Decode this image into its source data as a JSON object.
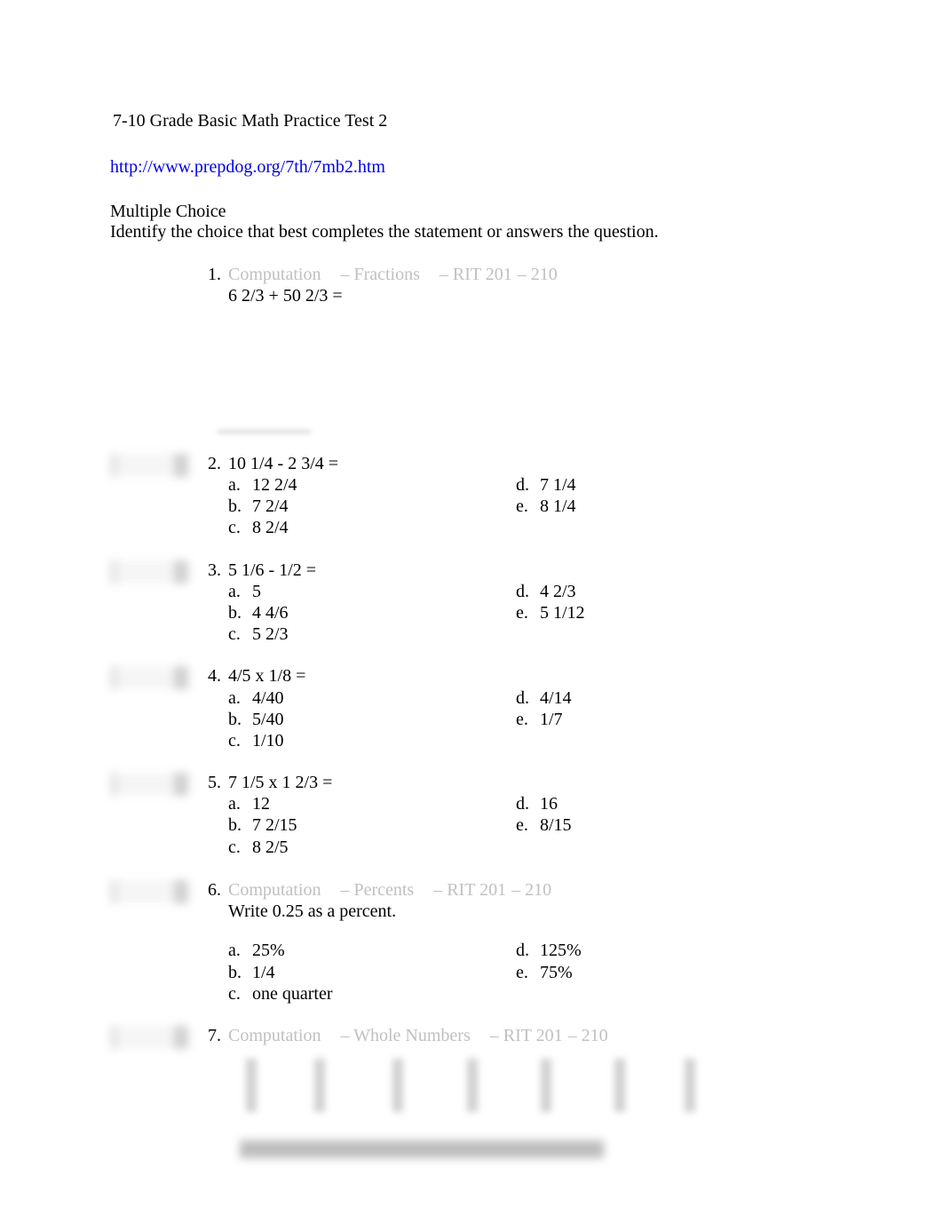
{
  "title": "7-10 Grade Basic Math Practice Test 2",
  "link": "http://www.prepdog.org/7th/7mb2.htm",
  "section_heading": "Multiple Choice",
  "instructions": "Identify the choice that best completes the statement or answers the question.",
  "questions": [
    {
      "number": "1.",
      "category": {
        "topic": "Computation",
        "subtopic": "– Fractions",
        "rit": "– RIT 201",
        "rit_end": "– 210"
      },
      "prompt": "6 2/3 + 50 2/3 =",
      "choices": []
    },
    {
      "number": "2.",
      "prompt": "10 1/4 - 2 3/4 =",
      "choices": [
        {
          "letter": "a.",
          "text": "12 2/4"
        },
        {
          "letter": "b.",
          "text": "7 2/4"
        },
        {
          "letter": "c.",
          "text": "8 2/4"
        },
        {
          "letter": "d.",
          "text": "7 1/4"
        },
        {
          "letter": "e.",
          "text": "8 1/4"
        }
      ]
    },
    {
      "number": "3.",
      "prompt": "5 1/6 - 1/2 =",
      "choices": [
        {
          "letter": "a.",
          "text": "5"
        },
        {
          "letter": "b.",
          "text": "4 4/6"
        },
        {
          "letter": "c.",
          "text": "5 2/3"
        },
        {
          "letter": "d.",
          "text": "4 2/3"
        },
        {
          "letter": "e.",
          "text": "5 1/12"
        }
      ]
    },
    {
      "number": "4.",
      "prompt": "4/5 x 1/8 =",
      "choices": [
        {
          "letter": "a.",
          "text": "4/40"
        },
        {
          "letter": "b.",
          "text": "5/40"
        },
        {
          "letter": "c.",
          "text": "1/10"
        },
        {
          "letter": "d.",
          "text": "4/14"
        },
        {
          "letter": "e.",
          "text": "1/7"
        }
      ]
    },
    {
      "number": "5.",
      "prompt": "7 1/5 x 1 2/3 =",
      "choices": [
        {
          "letter": "a.",
          "text": "12"
        },
        {
          "letter": "b.",
          "text": "7 2/15"
        },
        {
          "letter": "c.",
          "text": "8 2/5"
        },
        {
          "letter": "d.",
          "text": "16"
        },
        {
          "letter": "e.",
          "text": "8/15"
        }
      ]
    },
    {
      "number": "6.",
      "category": {
        "topic": "Computation",
        "subtopic": "– Percents",
        "rit": "– RIT 201",
        "rit_end": "– 210"
      },
      "prompt": "Write 0.25 as a percent.",
      "choices": [
        {
          "letter": "a.",
          "text": "25%"
        },
        {
          "letter": "b.",
          "text": "1/4"
        },
        {
          "letter": "c.",
          "text": "one quarter"
        },
        {
          "letter": "d.",
          "text": "125%"
        },
        {
          "letter": "e.",
          "text": "75%"
        }
      ]
    },
    {
      "number": "7.",
      "category": {
        "topic": "Computation",
        "subtopic": "– Whole Numbers",
        "rit": "– RIT 201",
        "rit_end": "– 210"
      }
    }
  ]
}
